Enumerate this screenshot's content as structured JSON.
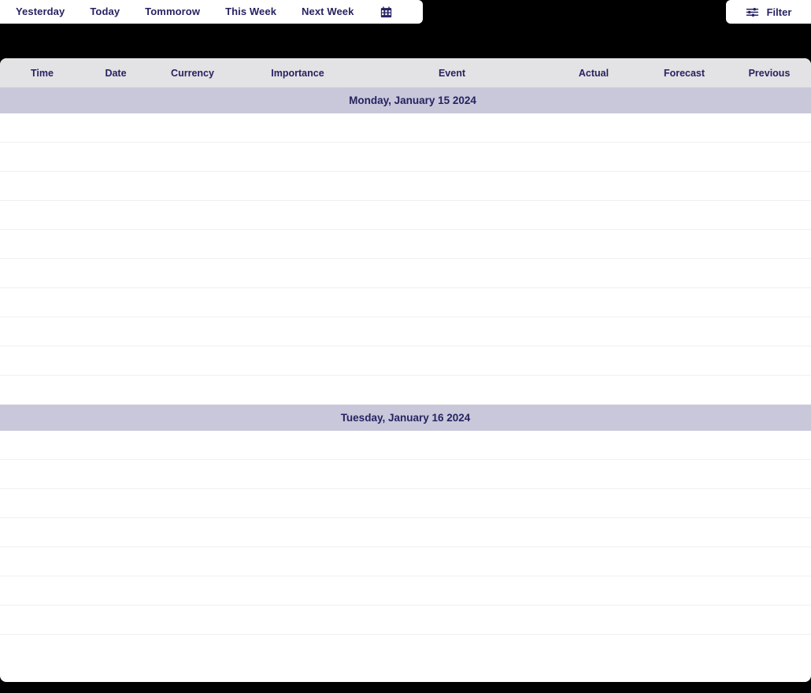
{
  "toolbar": {
    "nav_items": [
      {
        "label": "Yesterday",
        "name": "nav-yesterday"
      },
      {
        "label": "Today",
        "name": "nav-today"
      },
      {
        "label": "Tommorow",
        "name": "nav-tommorow"
      },
      {
        "label": "This Week",
        "name": "nav-this-week"
      },
      {
        "label": "Next Week",
        "name": "nav-next-week"
      }
    ],
    "calendar_icon": "calendar-icon",
    "filter": {
      "label": "Filter",
      "icon": "sliders-filter-icon"
    }
  },
  "table": {
    "columns": [
      {
        "label": "Time",
        "key": "time",
        "class": "col-time"
      },
      {
        "label": "Date",
        "key": "date",
        "class": "col-date"
      },
      {
        "label": "Currency",
        "key": "currency",
        "class": "col-currency"
      },
      {
        "label": "Importance",
        "key": "importance",
        "class": "col-import"
      },
      {
        "label": "Event",
        "key": "event",
        "class": "col-event"
      },
      {
        "label": "Actual",
        "key": "actual",
        "class": "col-actual"
      },
      {
        "label": "Forecast",
        "key": "forecast",
        "class": "col-forecast"
      },
      {
        "label": "Previous",
        "key": "previous",
        "class": "col-previous"
      }
    ],
    "groups": [
      {
        "day_label": "Monday, January 15 2024",
        "offset": "offset-mon",
        "rows": [
          {
            "time": "",
            "date": "",
            "currency": "",
            "importance": "",
            "event": "",
            "actual": "",
            "forecast": "",
            "previous": ""
          },
          {
            "time": "",
            "date": "",
            "currency": "",
            "importance": "",
            "event": "",
            "actual": "",
            "forecast": "",
            "previous": ""
          },
          {
            "time": "",
            "date": "",
            "currency": "",
            "importance": "",
            "event": "",
            "actual": "",
            "forecast": "",
            "previous": ""
          },
          {
            "time": "",
            "date": "",
            "currency": "",
            "importance": "",
            "event": "",
            "actual": "",
            "forecast": "",
            "previous": ""
          },
          {
            "time": "",
            "date": "",
            "currency": "",
            "importance": "",
            "event": "",
            "actual": "",
            "forecast": "",
            "previous": ""
          },
          {
            "time": "",
            "date": "",
            "currency": "",
            "importance": "",
            "event": "",
            "actual": "",
            "forecast": "",
            "previous": ""
          },
          {
            "time": "",
            "date": "",
            "currency": "",
            "importance": "",
            "event": "",
            "actual": "",
            "forecast": "",
            "previous": ""
          },
          {
            "time": "",
            "date": "",
            "currency": "",
            "importance": "",
            "event": "",
            "actual": "",
            "forecast": "",
            "previous": ""
          },
          {
            "time": "",
            "date": "",
            "currency": "",
            "importance": "",
            "event": "",
            "actual": "",
            "forecast": "",
            "previous": ""
          },
          {
            "time": "",
            "date": "",
            "currency": "",
            "importance": "",
            "event": "",
            "actual": "",
            "forecast": "",
            "previous": ""
          }
        ]
      },
      {
        "day_label": "Tuesday, January 16 2024",
        "offset": "",
        "rows": [
          {
            "time": "",
            "date": "",
            "currency": "",
            "importance": "",
            "event": "",
            "actual": "",
            "forecast": "",
            "previous": ""
          },
          {
            "time": "",
            "date": "",
            "currency": "",
            "importance": "",
            "event": "",
            "actual": "",
            "forecast": "",
            "previous": ""
          },
          {
            "time": "",
            "date": "",
            "currency": "",
            "importance": "",
            "event": "",
            "actual": "",
            "forecast": "",
            "previous": ""
          },
          {
            "time": "",
            "date": "",
            "currency": "",
            "importance": "",
            "event": "",
            "actual": "",
            "forecast": "",
            "previous": ""
          },
          {
            "time": "",
            "date": "",
            "currency": "",
            "importance": "",
            "event": "",
            "actual": "",
            "forecast": "",
            "previous": ""
          },
          {
            "time": "",
            "date": "",
            "currency": "",
            "importance": "",
            "event": "",
            "actual": "",
            "forecast": "",
            "previous": ""
          },
          {
            "time": "",
            "date": "",
            "currency": "",
            "importance": "",
            "event": "",
            "actual": "",
            "forecast": "",
            "previous": ""
          },
          {
            "time": "",
            "date": "",
            "currency": "",
            "importance": "",
            "event": "",
            "actual": "",
            "forecast": "",
            "previous": ""
          }
        ]
      }
    ]
  },
  "colors": {
    "accent_navy": "#262262",
    "header_bg": "#e3e2e4",
    "day_row_bg": "#c8c8da",
    "card_bg": "#ffffff",
    "page_bg": "#000000",
    "row_border": "#f0f0f2"
  }
}
